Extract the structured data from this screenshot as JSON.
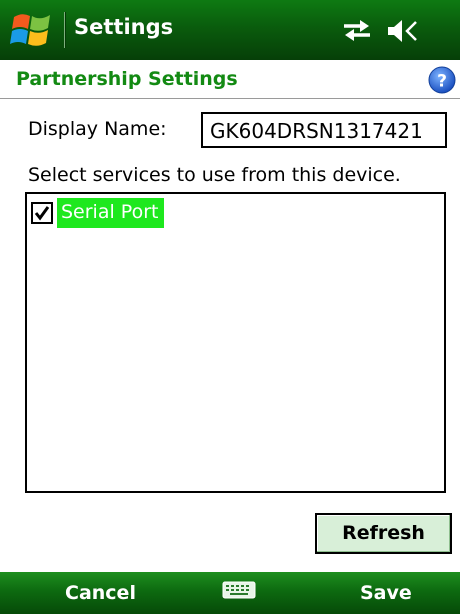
{
  "titlebar": {
    "title": "Settings",
    "icons": [
      "windows-start-icon",
      "connectivity-icon",
      "volume-muted-icon"
    ]
  },
  "header": {
    "title": "Partnership Settings",
    "help_icon": "help-icon"
  },
  "form": {
    "display_name_label": "Display Name:",
    "display_name_value": "GK604DRSN1317421",
    "instructions": "Select services to use from this device."
  },
  "services": [
    {
      "label": "Serial Port",
      "checked": true,
      "selected": true
    }
  ],
  "buttons": {
    "refresh": "Refresh"
  },
  "softkeys": {
    "left": "Cancel",
    "right": "Save",
    "center_icon": "keyboard-icon"
  },
  "colors": {
    "title_bar": "#0a5c0d",
    "header_text": "#138a13",
    "selection": "#1ee81e",
    "refresh_button": "#d8efd8"
  }
}
